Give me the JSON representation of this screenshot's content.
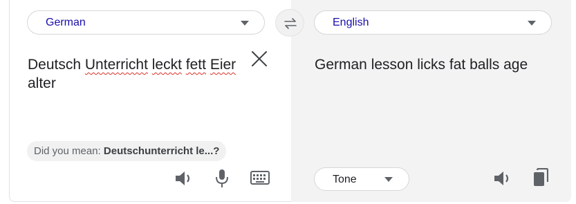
{
  "source": {
    "language": "German",
    "text_words": [
      "Deutsch",
      "Unterricht",
      "leckt",
      "fett",
      "Eier",
      "alter"
    ],
    "did_you_mean_prefix": "Did you mean: ",
    "did_you_mean_suggestion": "Deutschunterricht le...?"
  },
  "target": {
    "language": "English",
    "text": "German lesson licks fat balls age",
    "tone_label": "Tone"
  },
  "icons": {
    "swap": "swap-arrows-icon",
    "clear": "close-icon",
    "speak_source": "speaker-icon",
    "mic": "microphone-icon",
    "keyboard": "keyboard-icon",
    "speak_target": "speaker-icon",
    "copy": "copy-icon"
  },
  "colors": {
    "language_text": "#1a0dab",
    "spellcheck_underline": "#d93025",
    "icon_gray": "#5f6368"
  }
}
